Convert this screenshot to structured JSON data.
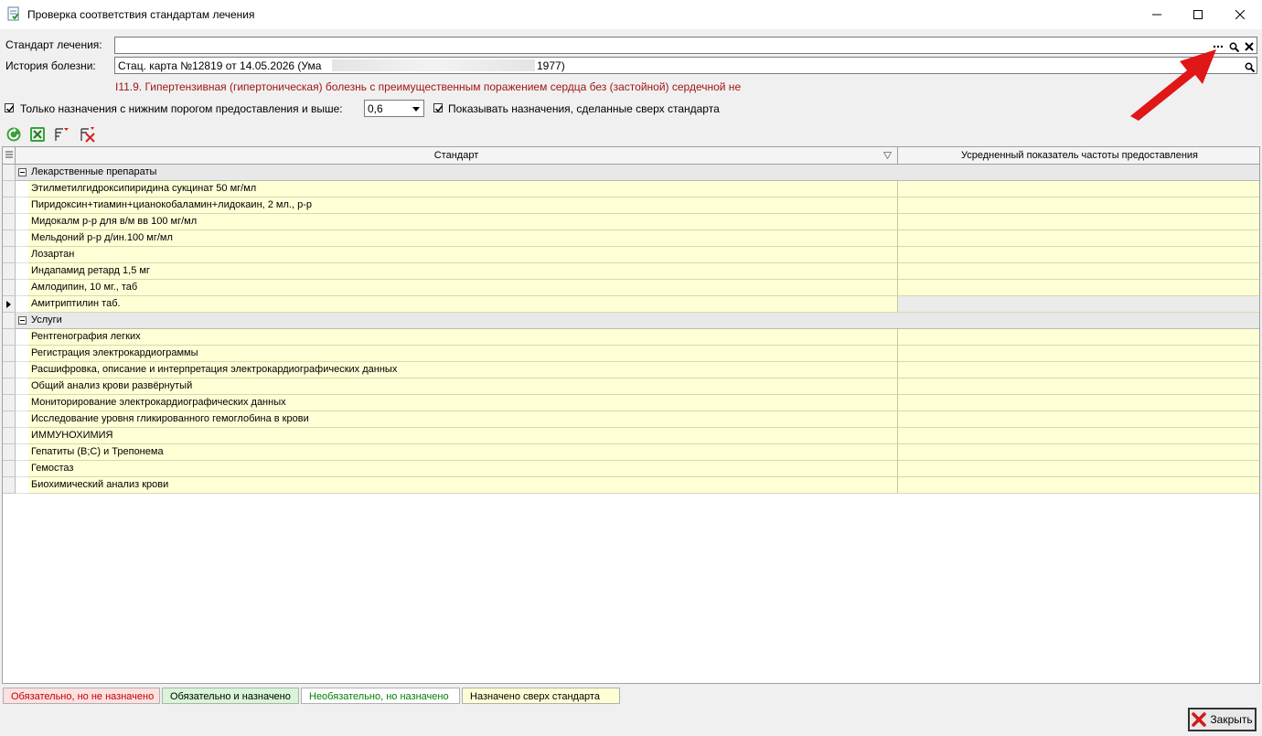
{
  "window": {
    "title": "Проверка соответствия стандартам лечения"
  },
  "form": {
    "standard_label": "Стандарт лечения:",
    "standard_value": "",
    "history_label": "История болезни:",
    "history_value_prefix": "Стац. карта №12819 от 14.05.2026 (Ума",
    "history_value_suffix": "1977)",
    "diagnosis": "I11.9. Гипертензивная (гипертоническая) болезнь с преимущественным поражением сердца без (застойной) сердечной не"
  },
  "filters": {
    "threshold_checkbox_label": "Только назначения с нижним порогом предоставления и выше:",
    "threshold_checked": true,
    "threshold_value": "0,6",
    "show_extra_checkbox_label": "Показывать назначения, сделанные сверх стандарта",
    "show_extra_checked": true
  },
  "grid": {
    "columns": [
      "Стандарт",
      "Усредненный показатель частоты предоставления"
    ],
    "groups": [
      {
        "name": "Лекарственные препараты",
        "items": [
          "Этилметилгидроксипиридина сукцинат 50 мг/мл",
          "Пиридоксин+тиамин+цианокобаламин+лидокаин, 2 мл., р-р",
          "Мидокалм р-р для в/м вв 100 мг/мл",
          "Мельдоний р-р д/ин.100 мг/мл",
          "Лозартан",
          "Индапамид ретард 1,5 мг",
          "Амлодипин, 10 мг., таб",
          "Амитриптилин таб."
        ]
      },
      {
        "name": "Услуги",
        "items": [
          "Рентгенография легких",
          "Регистрация электрокардиограммы",
          "Расшифровка, описание и интерпретация электрокардиографических данных",
          "Общий анализ крови развёрнутый",
          "Мониторирование электрокардиографических данных",
          "Исследование уровня гликированного гемоглобина в крови",
          "ИММУНОХИМИЯ",
          "Гепатиты (В;С) и Трепонема",
          "Гемостаз",
          "Биохимический анализ крови"
        ]
      }
    ]
  },
  "legend": [
    {
      "label": "Обязательно, но не назначено",
      "bg": "#fde0e0",
      "color": "#c00000"
    },
    {
      "label": "Обязательно и назначено",
      "bg": "#d8f5d8",
      "color": "#000000"
    },
    {
      "label": "Необязательно, но назначено",
      "bg": "#ffffff",
      "color": "#008000"
    },
    {
      "label": "Назначено сверх стандарта",
      "bg": "#ffffd6",
      "color": "#000000"
    }
  ],
  "buttons": {
    "close_label": "Закрыть"
  },
  "icons": [
    "app-icon",
    "ellipsis-icon",
    "search-icon",
    "clear-icon",
    "refresh-icon",
    "cancel-icon",
    "filter-icon",
    "clear-filter-icon",
    "close-red-x-icon"
  ]
}
